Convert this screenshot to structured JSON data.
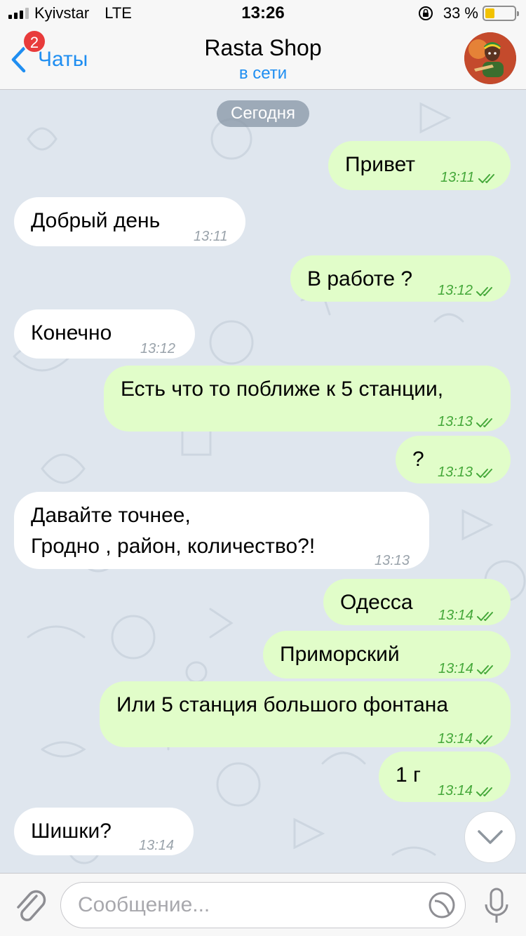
{
  "status_bar": {
    "carrier": "Kyivstar",
    "network": "LTE",
    "time": "13:26",
    "battery": "33 %",
    "battery_level": 0.33
  },
  "nav": {
    "back_label": "Чаты",
    "unread_badge": "2",
    "title": "Rasta Shop",
    "subtitle": "в сети"
  },
  "chat": {
    "date_label": "Сегодня",
    "messages": [
      {
        "dir": "out",
        "text": "Привет",
        "time": "13:11"
      },
      {
        "dir": "in",
        "text": "Добрый день",
        "time": "13:11"
      },
      {
        "dir": "out",
        "text": "В работе ?",
        "time": "13:12"
      },
      {
        "dir": "in",
        "text": "Конечно",
        "time": "13:12"
      },
      {
        "dir": "out",
        "text": "Есть что то поближе к 5 станции,",
        "time": "13:13"
      },
      {
        "dir": "out",
        "text": "?",
        "time": "13:13"
      },
      {
        "dir": "in",
        "text": "Давайте точнее,\nГродно , район, количество?!",
        "time": "13:13"
      },
      {
        "dir": "out",
        "text": "Одесса",
        "time": "13:14"
      },
      {
        "dir": "out",
        "text": "Приморский",
        "time": "13:14"
      },
      {
        "dir": "out",
        "text": "Или 5 станция большого фонтана",
        "time": "13:14"
      },
      {
        "dir": "out",
        "text": "1 г",
        "time": "13:14"
      },
      {
        "dir": "in",
        "text": "Шишки?",
        "time": "13:14"
      }
    ]
  },
  "input": {
    "placeholder": "Сообщение..."
  },
  "colors": {
    "accent": "#1f8ef1",
    "outgoing_bubble": "#e1fdc9",
    "incoming_bubble": "#ffffff",
    "read_ticks": "#45a83a",
    "badge": "#e83b3b"
  },
  "icons": [
    "back-chevron-icon",
    "rotation-lock-icon",
    "battery-icon",
    "paperclip-icon",
    "sticker-icon",
    "microphone-icon",
    "chevron-down-icon",
    "double-check-icon"
  ]
}
